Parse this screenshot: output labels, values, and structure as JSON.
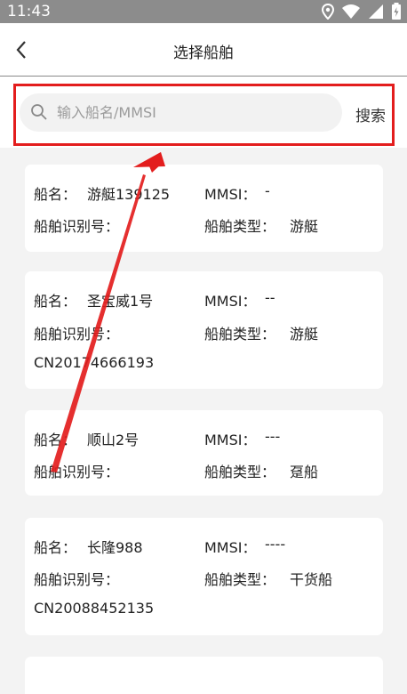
{
  "status_bar": {
    "time": "11:43"
  },
  "header": {
    "title": "选择船舶"
  },
  "search": {
    "placeholder": "输入船名/MMSI",
    "value": "",
    "button_label": "搜索"
  },
  "labels": {
    "name": "船名：",
    "mmsi": "MMSI：",
    "id": "船舶识别号：",
    "type": "船舶类型："
  },
  "ships": [
    {
      "name": "游艇139125",
      "mmsi": "-",
      "id": "",
      "type": "游艇"
    },
    {
      "name": "圣宝威1号",
      "mmsi": "--",
      "id": "CN20174666193",
      "type": "游艇"
    },
    {
      "name": "顺山2号",
      "mmsi": "---",
      "id": "",
      "type": "趸船"
    },
    {
      "name": "长隆988",
      "mmsi": "----",
      "id": "CN20088452135",
      "type": "干货船"
    }
  ],
  "colors": {
    "highlight": "#e31d1d",
    "status_bar": "#8c8c8c",
    "background": "#f3f3f3"
  }
}
